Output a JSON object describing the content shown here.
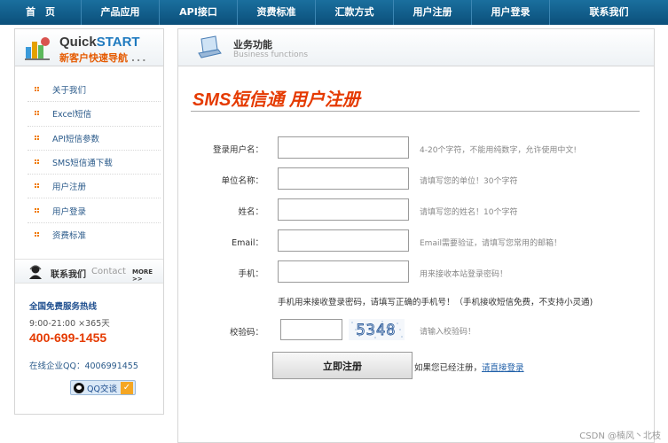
{
  "nav": {
    "items": [
      "首　页",
      "产品应用",
      "API接口",
      "资费标准",
      "汇款方式",
      "用户注册",
      "用户登录",
      "联系我们"
    ]
  },
  "quickstart": {
    "title_prefix": "Quick",
    "title_accent": "START",
    "subtitle": "新客户快速导航",
    "dots": "...",
    "menu": [
      "关于我们",
      "Excel短信",
      "API短信参数",
      "SMS短信通下载",
      "用户注册",
      "用户登录",
      "资费标准"
    ]
  },
  "contact": {
    "title": "联系我们",
    "title_en": "Contact",
    "more": "MORE >>",
    "hotline_label": "全国免费服务热线",
    "hours": "9:00-21:00 ×365天",
    "phone": "400-699-1455",
    "qq_line": "在线企业QQ：4006991455",
    "qq_button": "QQ交谈",
    "qq_check": "✓"
  },
  "business": {
    "title": "业务功能",
    "subtitle": "Business functions"
  },
  "page_title": "SMS短信通 用户注册",
  "form": {
    "fields": [
      {
        "label": "登录用户名：",
        "value": "",
        "hint": "4-20个字符，不能用纯数字，允许使用中文!"
      },
      {
        "label": "单位名称：",
        "value": "",
        "hint": "请填写您的单位！30个字符"
      },
      {
        "label": "姓名：",
        "value": "",
        "hint": "请填写您的姓名！10个字符"
      },
      {
        "label": "Email：",
        "value": "",
        "hint": "Email需要验证，请填写您常用的邮箱！"
      },
      {
        "label": "手机：",
        "value": "",
        "hint": "用来接收本站登录密码！"
      }
    ],
    "phone_note": "手机用来接收登录密码，请填写正确的手机号！（手机接收短信免费，不支持小灵通)",
    "captcha_label": "校验码：",
    "captcha_value": "",
    "captcha_text": "5348",
    "captcha_hint": "请输入校验码！",
    "submit_label": "立即注册",
    "already_text": "如果您已经注册，",
    "login_link": "请直接登录"
  },
  "watermark": "CSDN @楠风丶北枝",
  "colors": {
    "nav_bg": "#0b4f7a",
    "accent_orange": "#e53a00",
    "link_blue": "#2a5a8a"
  }
}
